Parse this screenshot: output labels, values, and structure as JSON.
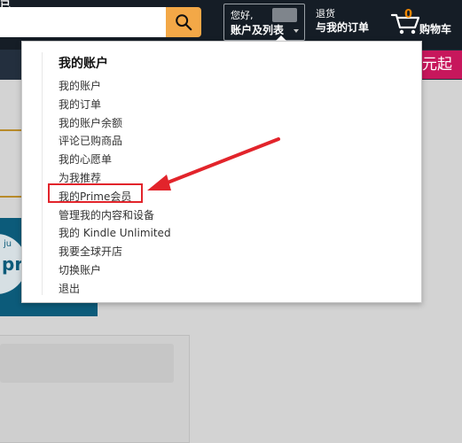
{
  "header": {
    "logo_fragment": "已",
    "search": {
      "value": "",
      "placeholder": ""
    },
    "account": {
      "greeting": "您好,",
      "label": "账户及列表"
    },
    "returns": {
      "line1": "退货",
      "line2": "与我的订单"
    },
    "cart": {
      "count": "0",
      "label": "购物车"
    }
  },
  "promo_fragment": "元起",
  "flyout": {
    "title": "我的账户",
    "items": [
      "我的账户",
      "我的订单",
      "我的账户余额",
      "评论已购商品",
      "我的心愿单",
      "为我推荐",
      "我的Prime会员",
      "管理我的内容和设备",
      "我的 Kindle Unlimited",
      "我要全球开店",
      "切换账户",
      "退出"
    ],
    "highlighted_item": "我的Prime会员"
  },
  "background": {
    "prime_just": "ju",
    "prime_text": "pr"
  },
  "colors": {
    "header": "#151d26",
    "subnav": "#232f3e",
    "search_button": "#f3a847",
    "cart_count": "#f08804",
    "promo": "#c7175c",
    "annotation": "#e2242b"
  }
}
